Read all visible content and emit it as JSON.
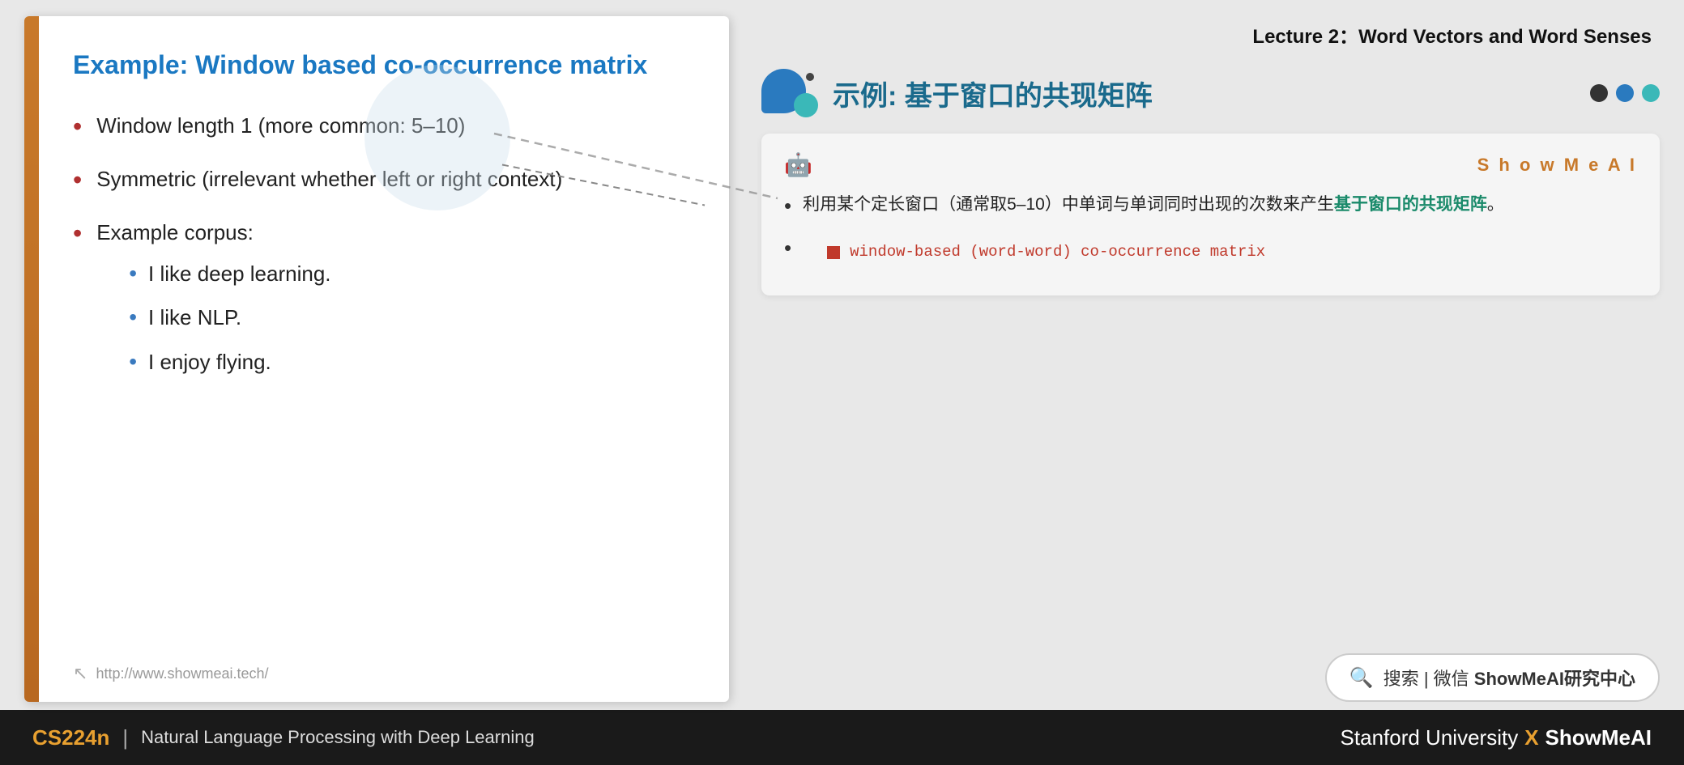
{
  "lecture": {
    "title": "Lecture 2：Word Vectors and Word Senses"
  },
  "slide": {
    "title": "Example: Window based co-occurrence matrix",
    "left_border_color": "#c8792a",
    "bullets": [
      {
        "text": "Window length 1 (more common: 5–10)"
      },
      {
        "text": "Symmetric (irrelevant whether left or right context)"
      },
      {
        "text": "Example corpus:",
        "sub_bullets": [
          "I like deep learning.",
          "I like NLP.",
          "I enjoy flying."
        ]
      }
    ],
    "footer_url": "http://www.showmeai.tech/"
  },
  "right_panel": {
    "chinese_title": "示例: 基于窗口的共现矩阵",
    "dots": [
      "dark",
      "blue",
      "teal"
    ],
    "card": {
      "showmeai_label": "S h o w M e A I",
      "bullet_1": "利用某个定长窗口（通常取5–10）中单词与单词同时出现的次数来产生",
      "highlight_text": "基于窗口的共现矩阵",
      "bullet_1_end": "。",
      "sub_item": "window-based (word-word) co-occurrence matrix"
    },
    "search_bar": {
      "icon": "🔍",
      "text": "搜索 | 微信 ShowMeAI研究中心"
    }
  },
  "bottom_bar": {
    "course_label": "CS224n",
    "divider": "|",
    "subtitle": "Natural Language Processing with Deep Learning",
    "stanford": "Stanford University",
    "x": "X",
    "showmeai": "ShowMeAI"
  }
}
